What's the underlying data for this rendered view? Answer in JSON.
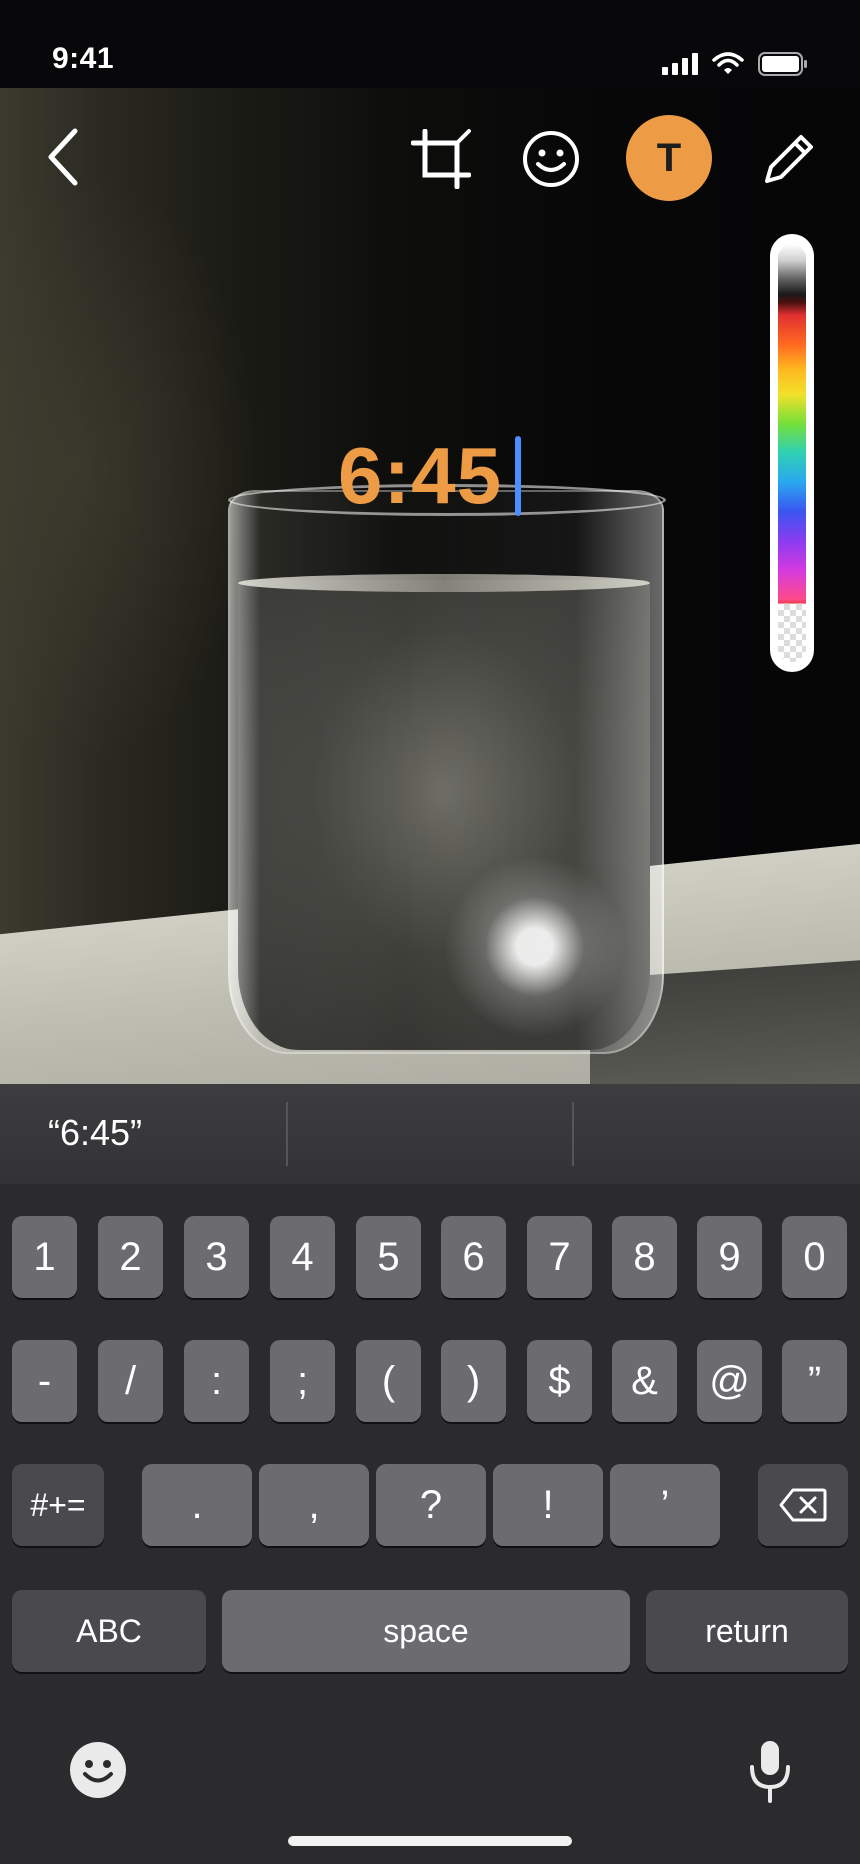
{
  "status_bar": {
    "time": "9:41"
  },
  "toolbar": {
    "back_icon": "chevron-left-icon",
    "crop_icon": "crop-icon",
    "emoji_icon": "smiley-icon",
    "text_button_label": "T",
    "pen_icon": "pencil-icon"
  },
  "editor": {
    "caption_text": "6:45",
    "caption_color": "#EE9B45",
    "cursor_color": "#4a8eff"
  },
  "keyboard": {
    "suggestions": [
      "“6:45”",
      "",
      ""
    ],
    "row1": [
      "1",
      "2",
      "3",
      "4",
      "5",
      "6",
      "7",
      "8",
      "9",
      "0"
    ],
    "row2": [
      "-",
      "/",
      ":",
      ";",
      "(",
      ")",
      "$",
      "&",
      "@",
      "”"
    ],
    "row3": {
      "toggle": "#+=",
      "keys": [
        ".",
        ",",
        "?",
        "!",
        "’"
      ]
    },
    "row4": {
      "abc": "ABC",
      "space": "space",
      "return": "return"
    }
  }
}
